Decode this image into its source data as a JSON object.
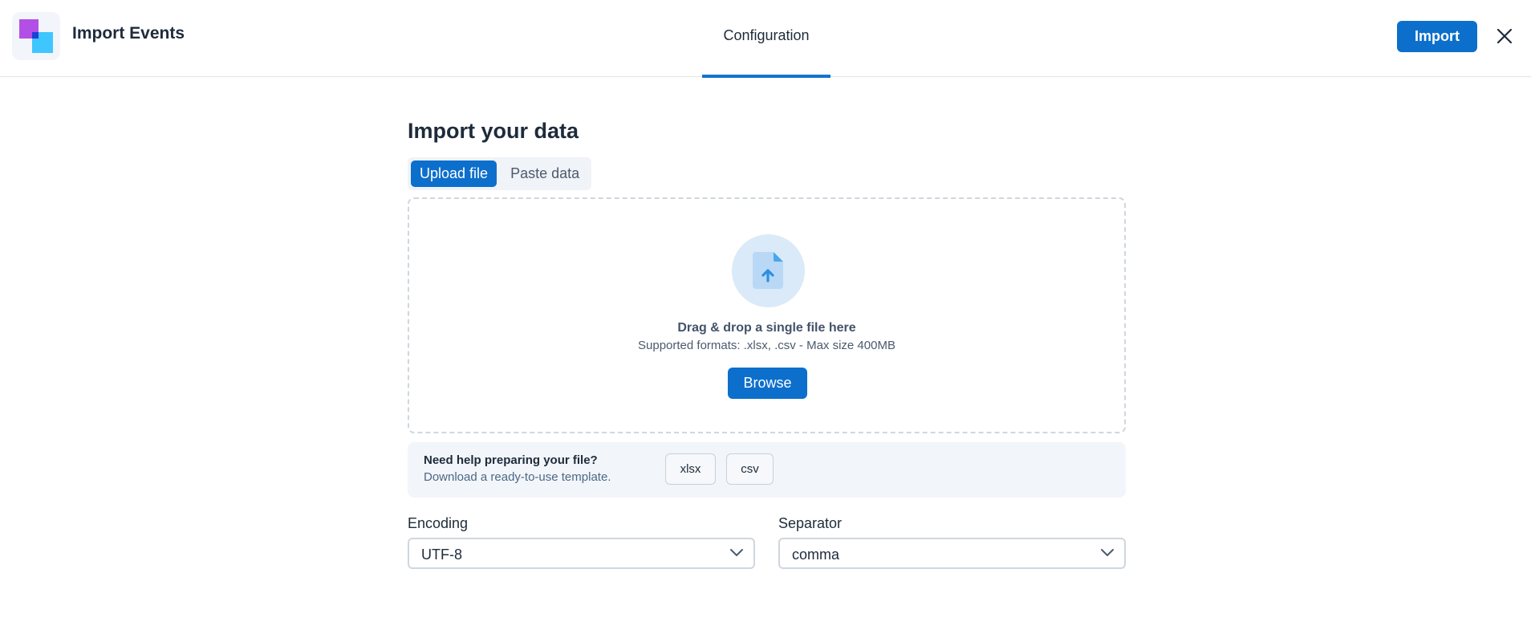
{
  "header": {
    "app_title": "Import Events",
    "tab_label": "Configuration",
    "import_label": "Import",
    "icons": {
      "logo": "app-logo",
      "close": "close-icon"
    }
  },
  "main": {
    "heading": "Import your data",
    "tabs": [
      {
        "label": "Upload file",
        "active": true
      },
      {
        "label": "Paste data",
        "active": false
      }
    ],
    "dropzone": {
      "icon": "file-upload-icon",
      "title": "Drag & drop a single file here",
      "subtitle": "Supported formats: .xlsx, .csv - Max size 400MB",
      "browse_label": "Browse"
    },
    "help": {
      "title": "Need help preparing your file?",
      "subtitle": "Download a ready-to-use template.",
      "templates": [
        "xlsx",
        "csv"
      ]
    },
    "encoding": {
      "label": "Encoding",
      "value": "UTF-8"
    },
    "separator": {
      "label": "Separator",
      "value": "comma"
    }
  },
  "colors": {
    "accent": "#0d6fcc",
    "logo_purple": "#b34fe6",
    "logo_blue": "#1e88ff",
    "logo_cyan": "#3fc6ff"
  }
}
